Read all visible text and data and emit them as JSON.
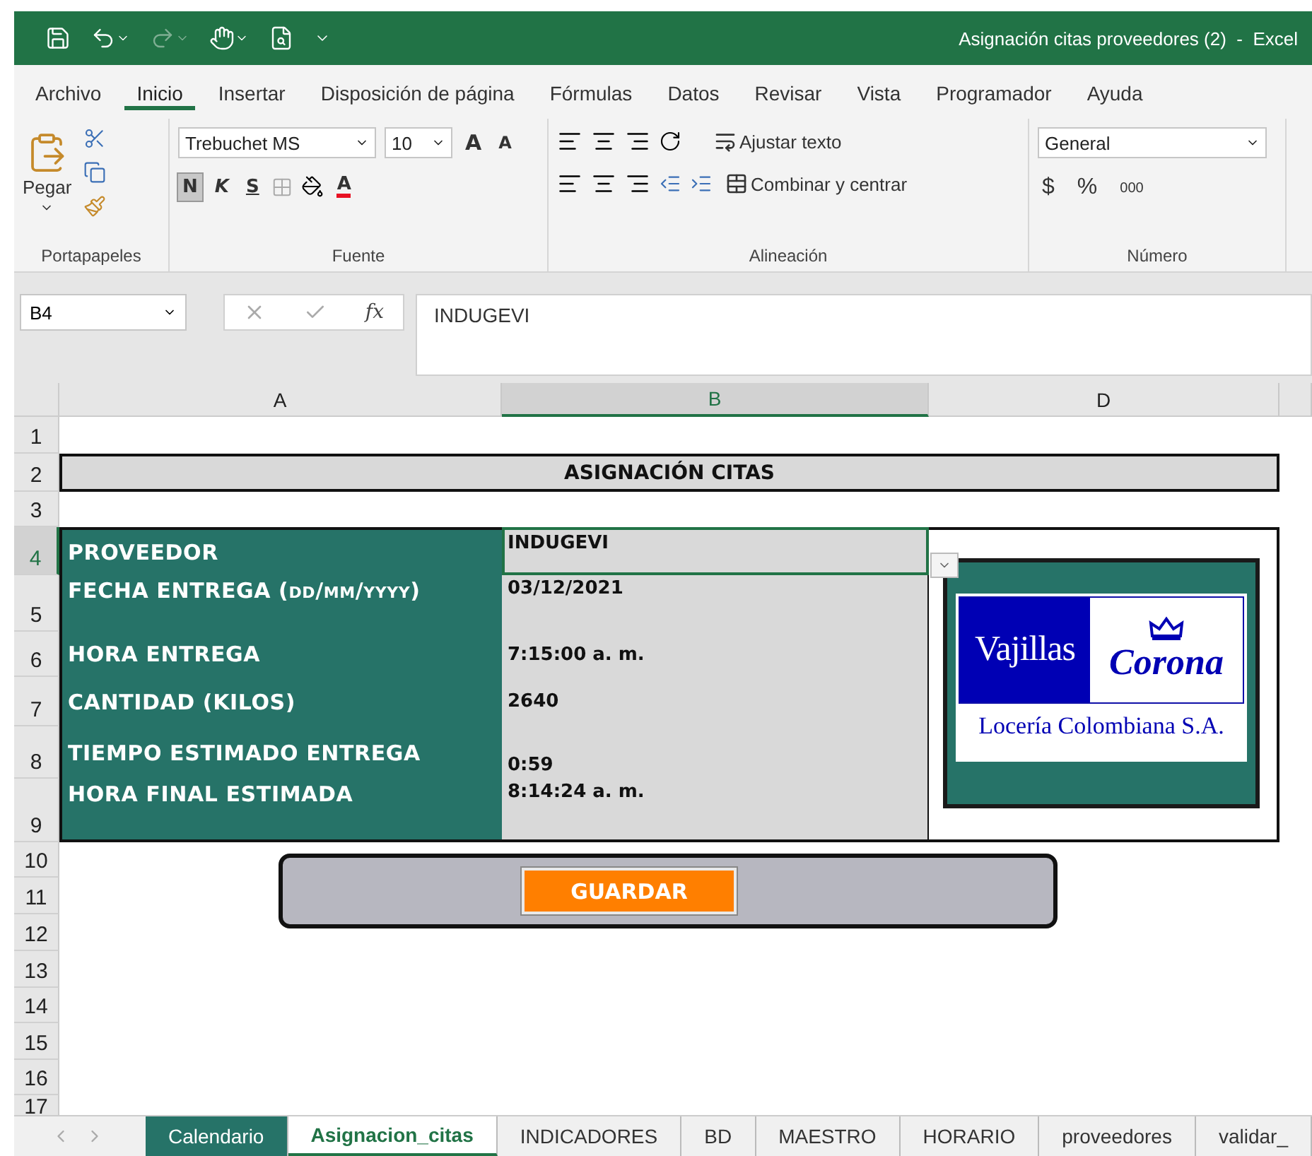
{
  "window": {
    "title": "Asignación citas proveedores (2)  -  Excel"
  },
  "menu_tabs": [
    {
      "label": "Archivo",
      "selected": false
    },
    {
      "label": "Inicio",
      "selected": true
    },
    {
      "label": "Insertar",
      "selected": false
    },
    {
      "label": "Disposición de página",
      "selected": false
    },
    {
      "label": "Fórmulas",
      "selected": false
    },
    {
      "label": "Datos",
      "selected": false
    },
    {
      "label": "Revisar",
      "selected": false
    },
    {
      "label": "Vista",
      "selected": false
    },
    {
      "label": "Programador",
      "selected": false
    },
    {
      "label": "Ayuda",
      "selected": false
    }
  ],
  "ribbon": {
    "clipboard": {
      "paste": "Pegar",
      "group": "Portapapeles"
    },
    "font": {
      "name": "Trebuchet MS",
      "size": "10",
      "grow": "A",
      "shrink": "A",
      "bold": "N",
      "italic": "K",
      "underline": "S",
      "font_color": "A",
      "group": "Fuente"
    },
    "alignment": {
      "wrap": "Ajustar texto",
      "merge": "Combinar y centrar",
      "group": "Alineación"
    },
    "number": {
      "format": "General",
      "currency": "$",
      "percent": "%",
      "thousands": "000",
      "group": "Número"
    }
  },
  "formula_bar": {
    "name_box": "B4",
    "fx": "fx",
    "value": "INDUGEVI"
  },
  "columns": [
    {
      "label": "A",
      "selected": false
    },
    {
      "label": "B",
      "selected": true
    },
    {
      "label": "D",
      "selected": false
    }
  ],
  "rows": [
    {
      "label": "1",
      "selected": false
    },
    {
      "label": "2",
      "selected": false
    },
    {
      "label": "3",
      "selected": false
    },
    {
      "label": "4",
      "selected": true
    },
    {
      "label": "5",
      "selected": false
    },
    {
      "label": "6",
      "selected": false
    },
    {
      "label": "7",
      "selected": false
    },
    {
      "label": "8",
      "selected": false
    },
    {
      "label": "9",
      "selected": false
    },
    {
      "label": "10",
      "selected": false
    },
    {
      "label": "11",
      "selected": false
    },
    {
      "label": "12",
      "selected": false
    },
    {
      "label": "13",
      "selected": false
    },
    {
      "label": "14",
      "selected": false
    },
    {
      "label": "15",
      "selected": false
    },
    {
      "label": "16",
      "selected": false
    },
    {
      "label": "17",
      "selected": false
    }
  ],
  "sheet": {
    "title": "ASIGNACIÓN CITAS",
    "fields": [
      {
        "label": "PROVEEDOR",
        "value": "INDUGEVI",
        "selected": true
      },
      {
        "label": "FECHA ENTREGA (dd/mm/yyyy)",
        "value": "03/12/2021",
        "selected": false
      },
      {
        "label": "HORA ENTREGA",
        "value": "7:15:00 a. m.",
        "selected": false
      },
      {
        "label": "CANTIDAD (KILOS)",
        "value": "2640",
        "selected": false
      },
      {
        "label": "TIEMPO ESTIMADO ENTREGA",
        "value": "0:59",
        "selected": false
      },
      {
        "label": "HORA FINAL ESTIMADA",
        "value": "8:14:24 a. m.",
        "selected": false
      }
    ],
    "logo": {
      "brand": "Vajillas",
      "brand2": "Corona",
      "subtitle": "Locería Colombiana S.A."
    },
    "save_button": "GUARDAR"
  },
  "sheet_tabs": [
    {
      "label": "Calendario",
      "selected": false,
      "color": "#267368"
    },
    {
      "label": "Asignacion_citas",
      "selected": true
    },
    {
      "label": "INDICADORES",
      "selected": false
    },
    {
      "label": "BD",
      "selected": false
    },
    {
      "label": "MAESTRO",
      "selected": false
    },
    {
      "label": "HORARIO",
      "selected": false
    },
    {
      "label": "proveedores",
      "selected": false
    },
    {
      "label": "validar_",
      "selected": false
    }
  ]
}
